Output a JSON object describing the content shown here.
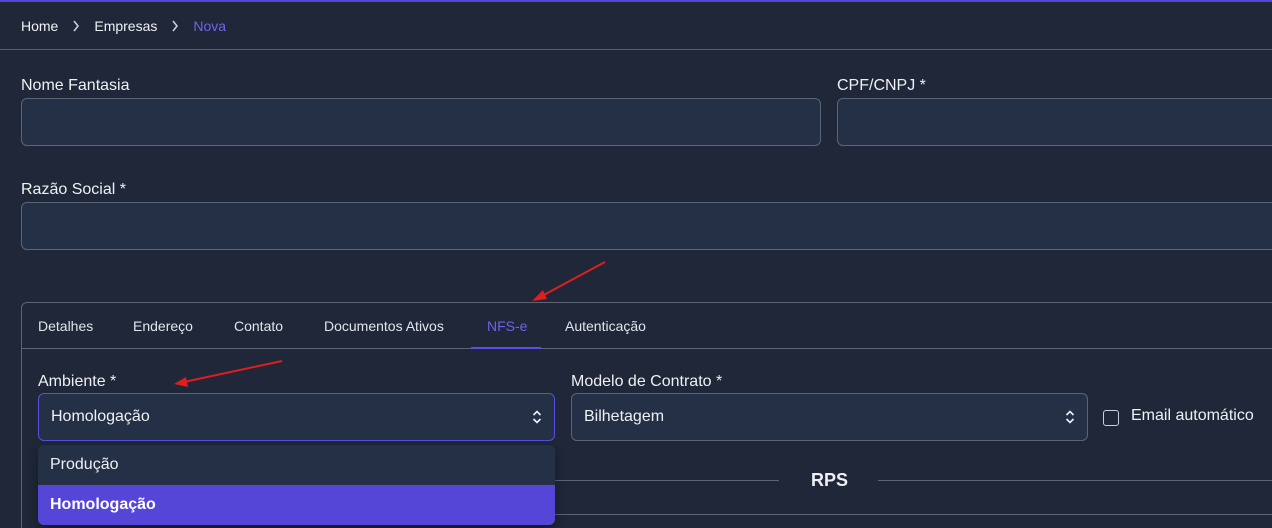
{
  "breadcrumb": {
    "items": [
      {
        "label": "Home"
      },
      {
        "label": "Empresas"
      },
      {
        "label": "Nova"
      }
    ]
  },
  "form": {
    "nome_fantasia": {
      "label": "Nome Fantasia",
      "value": ""
    },
    "cpf_cnpj": {
      "label": "CPF/CNPJ *",
      "value": ""
    },
    "razao_social": {
      "label": "Razão Social *",
      "value": ""
    }
  },
  "tabs": [
    {
      "label": "Detalhes"
    },
    {
      "label": "Endereço"
    },
    {
      "label": "Contato"
    },
    {
      "label": "Documentos Ativos"
    },
    {
      "label": "NFS-e",
      "active": true
    },
    {
      "label": "Autenticação"
    }
  ],
  "nfse": {
    "ambiente": {
      "label": "Ambiente *",
      "value": "Homologação",
      "options": [
        "Produção",
        "Homologação"
      ]
    },
    "modelo_contrato": {
      "label": "Modelo de Contrato *",
      "value": "Bilhetagem"
    },
    "email_automatico": {
      "label": "Email automático",
      "checked": false
    },
    "rps_title": "RPS"
  },
  "colors": {
    "accent": "#5546d8",
    "background": "#1f2738",
    "input_background": "#243045",
    "annotation_arrow": "#e01e1e"
  },
  "icons": {
    "breadcrumb_separator": "chevron-right-icon",
    "select_toggle": "chevron-up-down-icon"
  }
}
